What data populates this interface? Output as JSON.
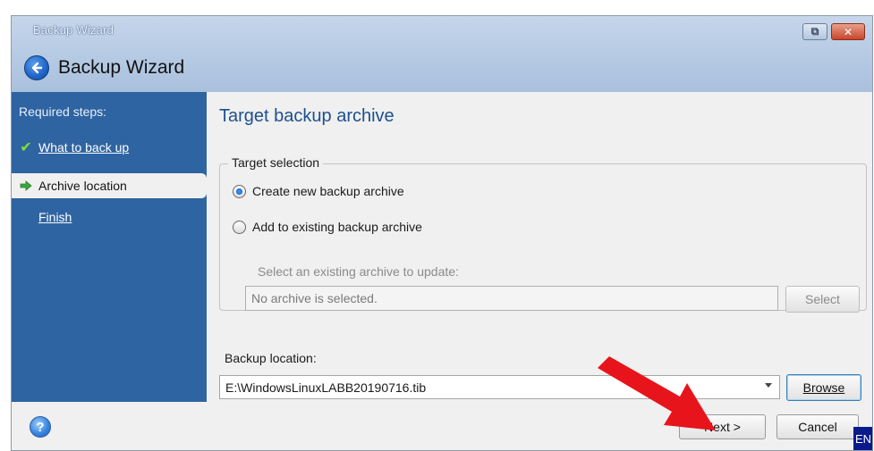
{
  "window": {
    "title": "Backup Wizard",
    "header_title": "Backup Wizard"
  },
  "sidebar": {
    "heading": "Required steps:",
    "items": [
      {
        "label": "What to back up",
        "state": "completed"
      },
      {
        "label": "Archive location",
        "state": "active"
      },
      {
        "label": "Finish",
        "state": "pending"
      }
    ]
  },
  "content": {
    "title": "Target backup archive",
    "target_selection": {
      "legend": "Target selection",
      "option_new": "Create new backup archive",
      "option_existing": "Add to existing backup archive",
      "selected": "new",
      "hint": "Select an existing archive to update:",
      "archive_value": "No archive is selected.",
      "select_label": "Select"
    },
    "location": {
      "label": "Backup location:",
      "value": "E:\\WindowsLinuxLABB20190716.tib",
      "browse_label": "Browse"
    }
  },
  "footer": {
    "help_glyph": "?",
    "next_label": "Next >",
    "cancel_label": "Cancel",
    "language": "EN"
  },
  "colors": {
    "sidebar": "#2f64a2",
    "title_accent": "#1e4f8e",
    "annotation_arrow": "#e8141b"
  }
}
